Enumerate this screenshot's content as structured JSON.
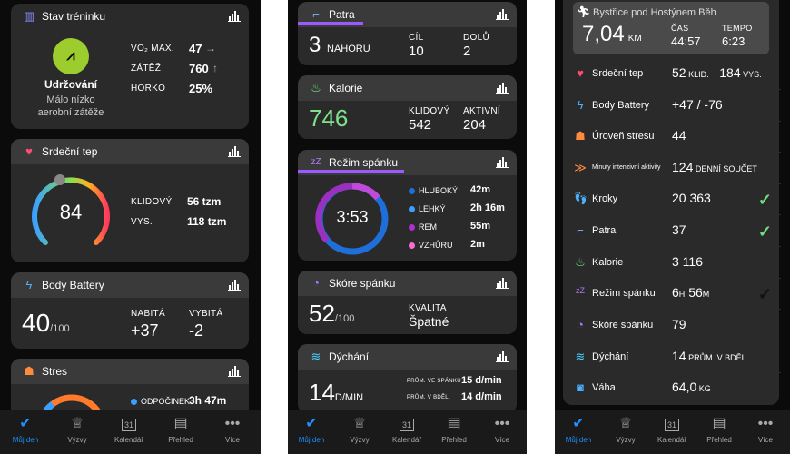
{
  "tabs": {
    "my_day": "Můj den",
    "challenges": "Výzvy",
    "calendar": "Kalendář",
    "overview": "Přehled",
    "more": "Více",
    "calendar_day": "31"
  },
  "p1": {
    "training": {
      "title": "Stav tréninku",
      "vo2_label": "VO₂ MAX.",
      "vo2_value": "47",
      "vo2_arrow": "→",
      "load_label": "ZÁTĚŽ",
      "load_value": "760",
      "load_arrow": "↑",
      "heat_label": "HORKO",
      "heat_value": "25%",
      "status": "Udržování",
      "status_sub1": "Málo nízko",
      "status_sub2": "aerobní zátěže"
    },
    "heart": {
      "title": "Srdeční tep",
      "value": "84",
      "rest_label": "KLIDOVÝ",
      "rest_value": "56 tzm",
      "high_label": "VYS.",
      "high_value": "118 tzm"
    },
    "battery": {
      "title": "Body Battery",
      "value": "40",
      "unit": "/100",
      "charged_label": "NABITÁ",
      "charged_value": "+37",
      "drained_label": "VYBITÁ",
      "drained_value": "-2"
    },
    "stress": {
      "title": "Stres",
      "rest_label": "ODPOČINEK",
      "rest_value": "3h 47m"
    }
  },
  "p2": {
    "floors": {
      "title": "Patra",
      "value": "3",
      "unit": "NAHORU",
      "goal_label": "CÍL",
      "goal_value": "10",
      "down_label": "DOLŮ",
      "down_value": "2"
    },
    "calories": {
      "title": "Kalorie",
      "value": "746",
      "rest_label": "KLIDOVÝ",
      "rest_value": "542",
      "active_label": "AKTIVNÍ",
      "active_value": "204"
    },
    "sleep": {
      "title": "Režim spánku",
      "value": "3:53",
      "deep_label": "HLUBOKÝ",
      "deep_value": "42m",
      "light_label": "LEHKÝ",
      "light_value": "2h 16m",
      "rem_label": "REM",
      "rem_value": "55m",
      "awake_label": "VZHŮRU",
      "awake_value": "2m"
    },
    "sleep_score": {
      "title": "Skóre spánku",
      "value": "52",
      "unit": "/100",
      "quality_label": "KVALITA",
      "quality_value": "Špatné"
    },
    "breathing": {
      "title": "Dýchání",
      "value": "14",
      "unit": "D/MIN",
      "sleep_label": "PRŮM. VE SPÁNKU",
      "sleep_value": "15 d/min",
      "awake_label": "PRŮM. V BDĚL.",
      "awake_value": "14 d/min"
    }
  },
  "p3": {
    "run": {
      "title": "Bystřice pod Hostýnem Běh",
      "distance": "7,04",
      "distance_unit": "KM",
      "time_label": "ČAS",
      "time_value": "44:57",
      "pace_label": "TEMPO",
      "pace_value": "6:23"
    },
    "rows": [
      {
        "label": "Srdeční tep",
        "value": "52",
        "unit": " KLID.",
        "value2": "184",
        "unit2": " VYS."
      },
      {
        "label": "Body Battery",
        "value": "+47 / -76",
        "unit": ""
      },
      {
        "label": "Úroveň stresu",
        "value": "44",
        "unit": ""
      },
      {
        "label": "Minuty intenzivní aktivity",
        "value": "124",
        "unit": " DENNÍ SOUČET"
      },
      {
        "label": "Kroky",
        "value": "20 363",
        "unit": ""
      },
      {
        "label": "Patra",
        "value": "37",
        "unit": ""
      },
      {
        "label": "Kalorie",
        "value": "3 116",
        "unit": ""
      },
      {
        "label": "Režim spánku",
        "value": "6",
        "unit": "H",
        "value2": "56",
        "unit2": "M"
      },
      {
        "label": "Skóre spánku",
        "value": "79",
        "unit": ""
      },
      {
        "label": "Dýchání",
        "value": "14",
        "unit": " PRŮM. V BDĚL."
      },
      {
        "label": "Váha",
        "value": "64,0",
        "unit": " KG"
      }
    ]
  },
  "icons": {
    "check": "✓"
  }
}
